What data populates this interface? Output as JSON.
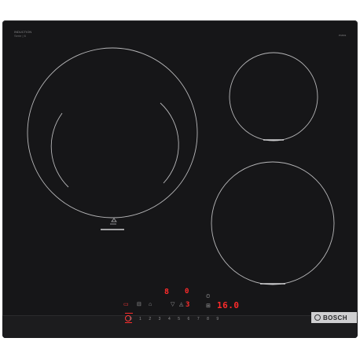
{
  "brand": {
    "series_line1": "INDUCTION",
    "series_line2": "Serie | 6",
    "model_code": "PIJ631",
    "logo_text": "BOSCH"
  },
  "display": {
    "left_zone_level": "8",
    "left_zone_indicator": "0",
    "center_level": "3",
    "timer_value": "16.0"
  },
  "controls": {
    "power_icon": "power-icon",
    "slider_digits": [
      "0",
      "1",
      "2",
      "3",
      "4",
      "5",
      "6",
      "7",
      "8",
      "9"
    ]
  },
  "colors": {
    "glass": "#161618",
    "zone_line": "#b8b8ba",
    "display_red": "#ff2b2b",
    "badge": "#cfcfd1"
  }
}
